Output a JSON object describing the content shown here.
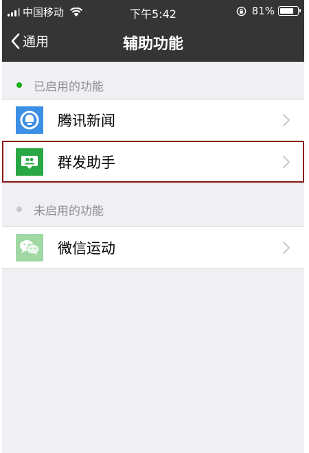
{
  "status_bar": {
    "carrier": "中国移动",
    "time": "下午5:42",
    "battery_percent": "81%",
    "battery_level": 0.81
  },
  "nav": {
    "back_label": "通用",
    "title": "辅助功能"
  },
  "sections": [
    {
      "header": "已启用的功能",
      "dot_color": "#1aad19",
      "items": [
        {
          "label": "腾讯新闻",
          "icon": "tencent-news-icon",
          "icon_color": "#3b8fe5"
        },
        {
          "label": "群发助手",
          "icon": "group-send-icon",
          "icon_color": "#29a745",
          "selected": true
        }
      ]
    },
    {
      "header": "未启用的功能",
      "dot_color": "#c7c7cc",
      "items": [
        {
          "label": "微信运动",
          "icon": "wechat-sport-icon",
          "icon_color": "#9fd8a2"
        }
      ]
    }
  ],
  "colors": {
    "bar_background": "#353535",
    "page_background": "#efeff4",
    "highlight_border": "#8b1a1a"
  }
}
